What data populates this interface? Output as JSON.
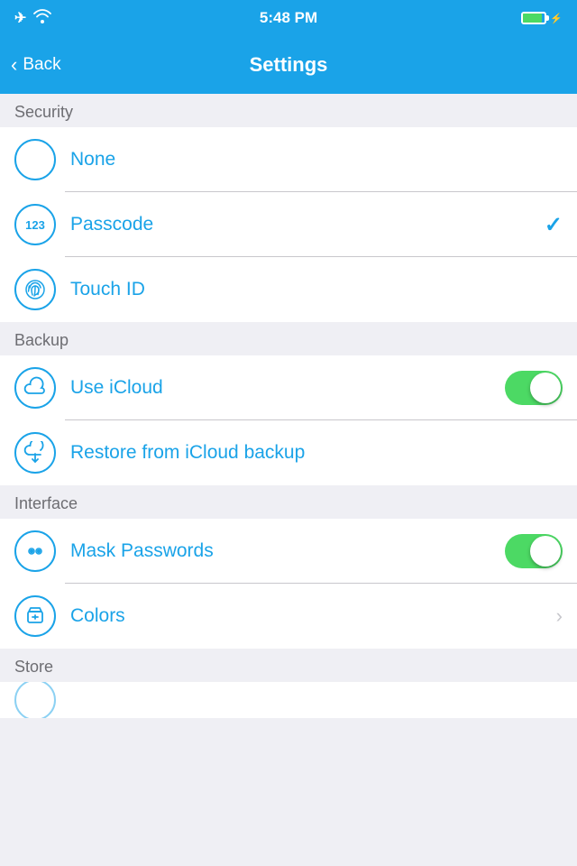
{
  "statusBar": {
    "time": "5:48 PM",
    "batteryLevel": 85
  },
  "navBar": {
    "backLabel": "Back",
    "title": "Settings"
  },
  "sections": [
    {
      "id": "security",
      "header": "Security",
      "rows": [
        {
          "id": "none",
          "label": "None",
          "icon": "circle",
          "accessory": "none"
        },
        {
          "id": "passcode",
          "label": "Passcode",
          "icon": "123",
          "accessory": "checkmark"
        },
        {
          "id": "touchid",
          "label": "Touch ID",
          "icon": "fingerprint",
          "accessory": "none"
        }
      ]
    },
    {
      "id": "backup",
      "header": "Backup",
      "rows": [
        {
          "id": "useicloud",
          "label": "Use iCloud",
          "icon": "cloud",
          "accessory": "toggle-on"
        },
        {
          "id": "restoreicloud",
          "label": "Restore from iCloud backup",
          "icon": "cloud-download",
          "accessory": "none"
        }
      ]
    },
    {
      "id": "interface",
      "header": "Interface",
      "rows": [
        {
          "id": "maskpasswords",
          "label": "Mask Passwords",
          "icon": "eyes",
          "accessory": "toggle-on"
        },
        {
          "id": "colors",
          "label": "Colors",
          "icon": "bucket",
          "accessory": "chevron"
        }
      ]
    },
    {
      "id": "store",
      "header": "Store",
      "rows": []
    }
  ],
  "colors": {
    "accent": "#1aa3e8",
    "toggleOn": "#4cd964",
    "separator": "#c8c7cc",
    "sectionBg": "#efeff4",
    "chevron": "#c7c7cc"
  }
}
